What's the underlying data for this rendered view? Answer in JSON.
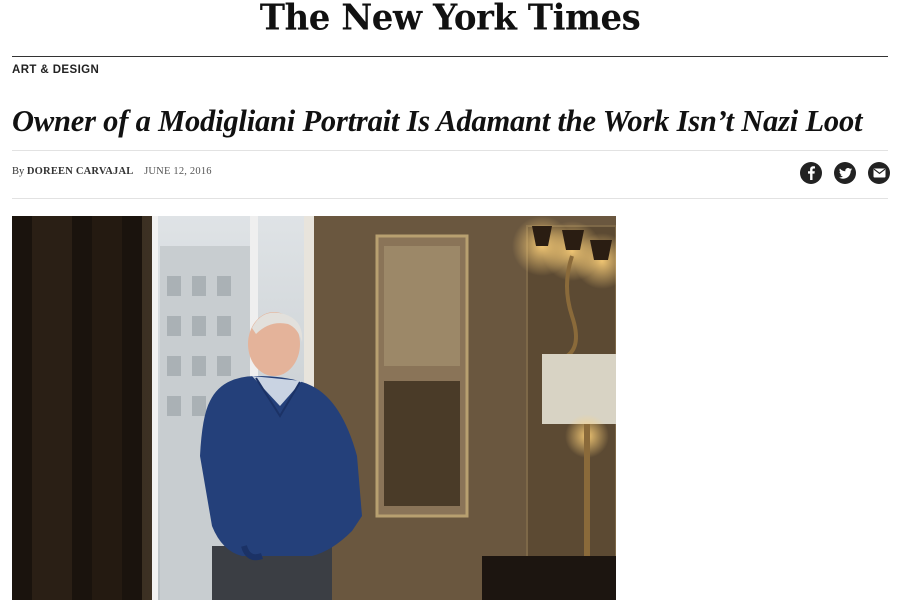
{
  "masthead": {
    "logo_text": "The New York Times"
  },
  "article": {
    "section": "ART & DESIGN",
    "headline": "Owner of a Modigliani Portrait Is Adamant the Work Isn’t Nazi Loot",
    "byline_prefix": "By",
    "author": "DOREEN CARVAJAL",
    "date": "JUNE 12, 2016"
  },
  "share": [
    {
      "name": "facebook",
      "icon": "facebook-icon"
    },
    {
      "name": "twitter",
      "icon": "twitter-icon"
    },
    {
      "name": "email",
      "icon": "email-icon"
    }
  ],
  "photo": {
    "subject": "elderly man in blue sweater standing by a window in an ornate room"
  },
  "colors": {
    "text": "#121212",
    "rule": "#e2e2e2",
    "icon_bg": "#222222"
  }
}
